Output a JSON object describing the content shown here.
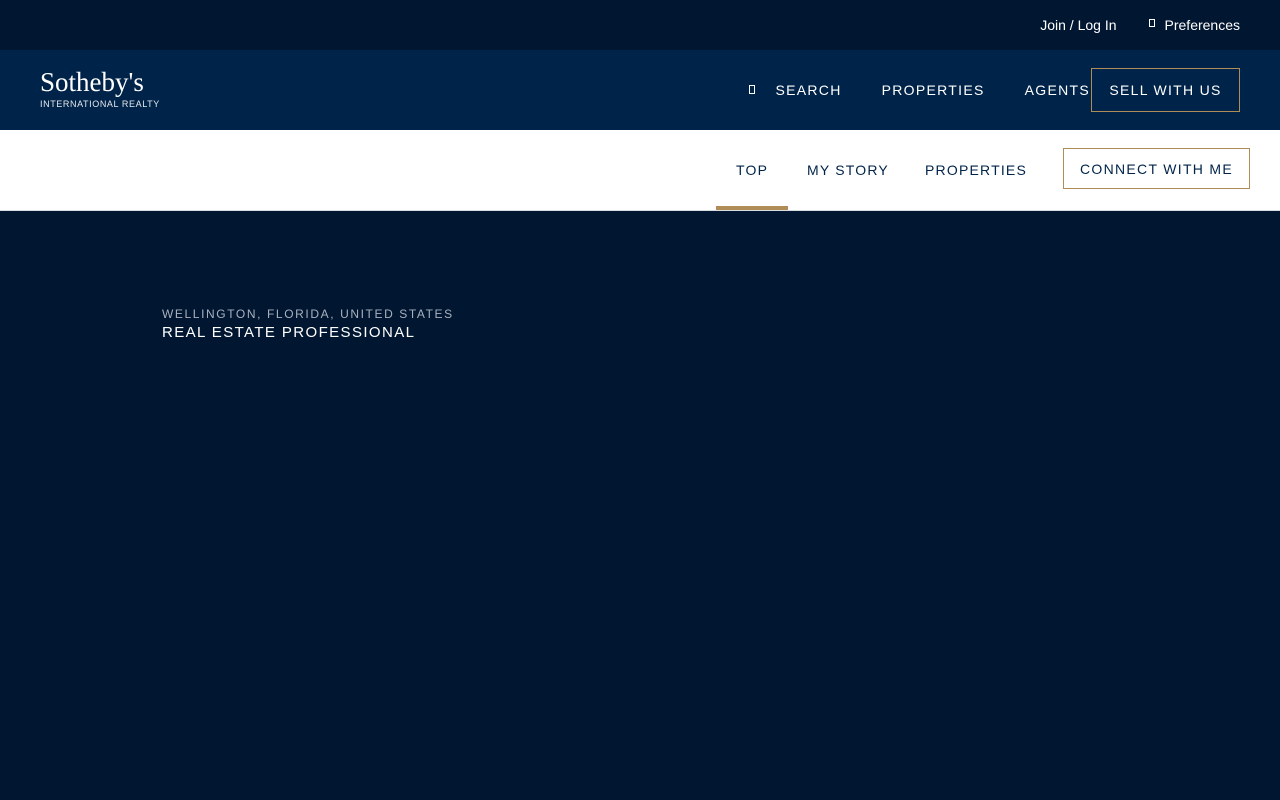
{
  "utility": {
    "login_label": "Join / Log In",
    "preferences_label": "Preferences",
    "preferences_icon": "preferences-icon"
  },
  "brand": {
    "name": "Sotheby's",
    "sub": "INTERNATIONAL REALTY"
  },
  "main_nav": {
    "search_label": "SEARCH",
    "search_icon": "search-icon",
    "properties_label": "PROPERTIES",
    "agents_label": "AGENTS",
    "sell_label": "SELL WITH US"
  },
  "sub_nav": {
    "tabs": [
      {
        "label": "TOP",
        "active": true
      },
      {
        "label": "MY STORY",
        "active": false
      },
      {
        "label": "PROPERTIES",
        "active": false
      }
    ],
    "connect_label": "CONNECT WITH ME"
  },
  "hero": {
    "location": "WELLINGTON, FLORIDA, UNITED STATES",
    "role": "REAL ESTATE PROFESSIONAL"
  },
  "colors": {
    "navy_dark": "#001631",
    "navy": "#002349",
    "gold_accent": "#b08d57",
    "white": "#ffffff"
  }
}
